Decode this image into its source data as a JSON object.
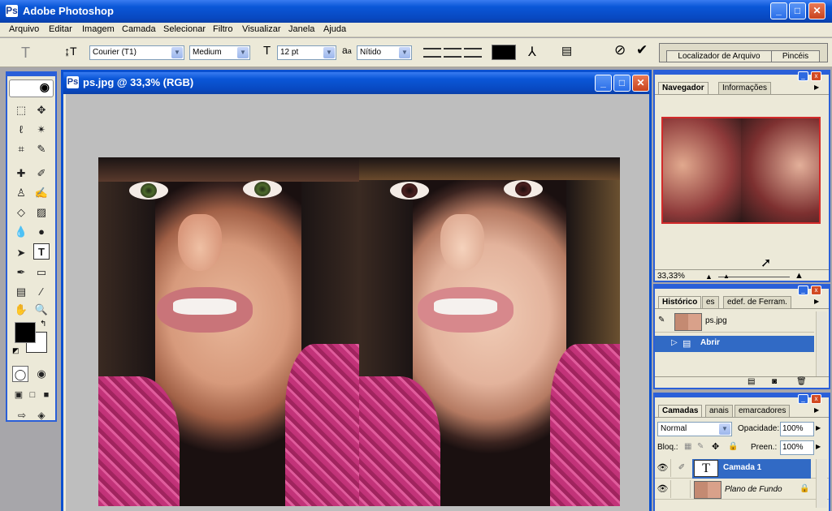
{
  "app": {
    "title": "Adobe Photoshop",
    "icon": "photoshop-icon"
  },
  "window_controls": {
    "minimize": "_",
    "maximize": "□",
    "close": "✕"
  },
  "menu": [
    "Arquivo",
    "Editar",
    "Imagem",
    "Camada",
    "Selecionar",
    "Filtro",
    "Visualizar",
    "Janela",
    "Ajuda"
  ],
  "options_bar": {
    "tool_preset_icon": "type-tool-icon",
    "orientation_icon": "text-orientation-icon",
    "font_family": "Courier (T1)",
    "font_style": "Medium",
    "font_size": "12 pt",
    "antialias_label": "a",
    "antialias_label2": "a",
    "antialias": "Nítido",
    "text_color": "#000000",
    "cancel_icon": "cancel-icon",
    "commit_icon": "commit-check-icon",
    "well_tabs": [
      "Localizador de Arquivo",
      "Pincéis"
    ]
  },
  "document": {
    "title": "ps.jpg @ 33,3% (RGB)"
  },
  "navigator": {
    "tabs": [
      "Navegador",
      "Informações"
    ],
    "zoom": "33,33%"
  },
  "history": {
    "tabs": [
      "Histórico",
      "es",
      "edef. de Ferram."
    ],
    "snapshot": "ps.jpg",
    "steps": [
      {
        "label": "Abrir",
        "selected": true
      }
    ]
  },
  "layers": {
    "tabs": [
      "Camadas",
      "anais",
      "emarcadores"
    ],
    "blend_mode": "Normal",
    "opacity_label": "Opacidade:",
    "opacity": "100%",
    "lock_label": "Bloq.:",
    "fill_label": "Preen.:",
    "fill": "100%",
    "items": [
      {
        "name": "Camada 1",
        "type": "text",
        "selected": true
      },
      {
        "name": "Plano de Fundo",
        "type": "image",
        "selected": false
      }
    ]
  },
  "colors": {
    "title_blue": "#0a57d8",
    "selection_blue": "#316ac5",
    "panel_bg": "#ece9d8"
  }
}
